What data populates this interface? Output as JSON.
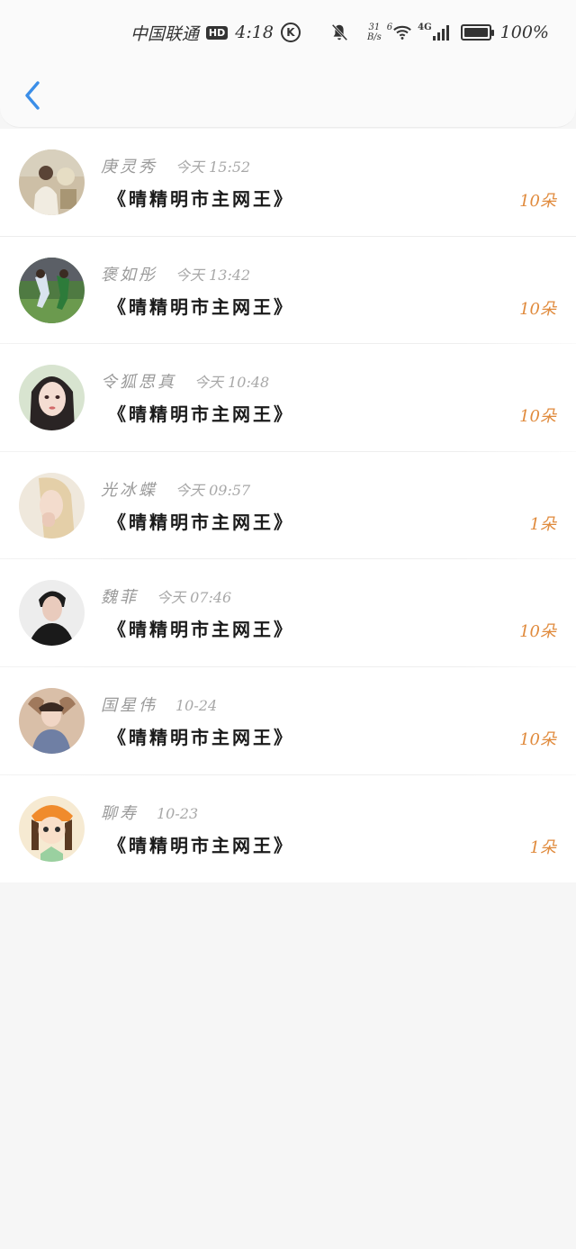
{
  "status_bar": {
    "carrier": "中国联通",
    "hd": "HD",
    "time": "4:18",
    "k_badge": "K",
    "speed_value": "31",
    "speed_unit": "B/s",
    "wifi_label": "6",
    "signal_label": "4G",
    "battery": "100%"
  },
  "header": {
    "back_icon": "chevron-left-icon",
    "accent_color": "#3b8ee8"
  },
  "items": [
    {
      "name": "庚灵秀",
      "time": "今天 15:52",
      "title": "《晴精明市主网王》",
      "count": "10朵"
    },
    {
      "name": "褒如彤",
      "time": "今天 13:42",
      "title": "《晴精明市主网王》",
      "count": "10朵"
    },
    {
      "name": "令狐思真",
      "time": "今天 10:48",
      "title": "《晴精明市主网王》",
      "count": "10朵"
    },
    {
      "name": "光冰蝶",
      "time": "今天 09:57",
      "title": "《晴精明市主网王》",
      "count": "1朵"
    },
    {
      "name": "魏菲",
      "time": "今天 07:46",
      "title": "《晴精明市主网王》",
      "count": "10朵"
    },
    {
      "name": "国星伟",
      "time": "10-24",
      "title": "《晴精明市主网王》",
      "count": "10朵"
    },
    {
      "name": "聊寿",
      "time": "10-23",
      "title": "《晴精明市主网王》",
      "count": "1朵"
    }
  ],
  "colors": {
    "count": "#e08a3c",
    "meta": "#9a9a9a",
    "background": "#f6f6f6"
  }
}
